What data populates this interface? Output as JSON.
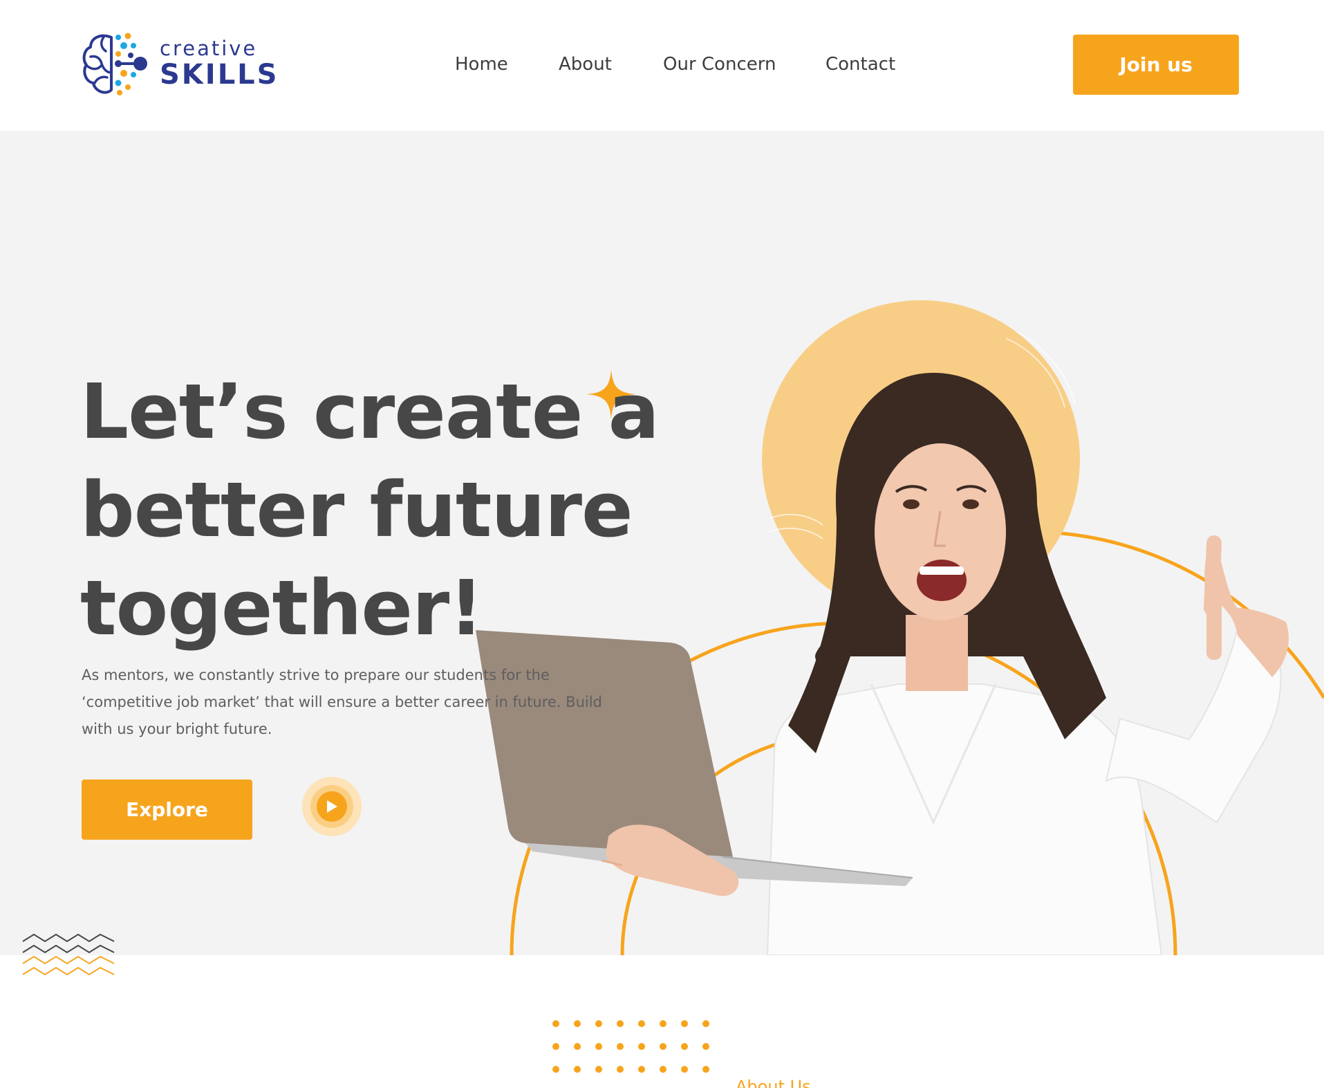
{
  "brand": {
    "line1": "creative",
    "line2": "SKILLS",
    "colors": {
      "navy": "#2b3990",
      "cyan": "#1ea7e1",
      "orange": "#f7a41d"
    }
  },
  "nav": {
    "items": [
      {
        "label": "Home"
      },
      {
        "label": "About"
      },
      {
        "label": "Our Concern"
      },
      {
        "label": "Contact"
      }
    ],
    "cta_label": "Join us"
  },
  "hero": {
    "title_lines": [
      "Let’s create a",
      "better future",
      "together!"
    ],
    "description": "As mentors, we constantly strive to prepare our students for the ‘competitive job market’ that will ensure a better career in future. Build with us your bright future.",
    "explore_label": "Explore",
    "play_icon": "play-icon",
    "image_subject": "smiling woman holding a laptop and pointing up"
  },
  "about_section": {
    "heading_peek": "About Us"
  },
  "colors": {
    "accent": "#f7a41d",
    "hero_bg": "#f3f3f3",
    "text_dark": "#474747",
    "circle_fill": "#f8ce87"
  }
}
